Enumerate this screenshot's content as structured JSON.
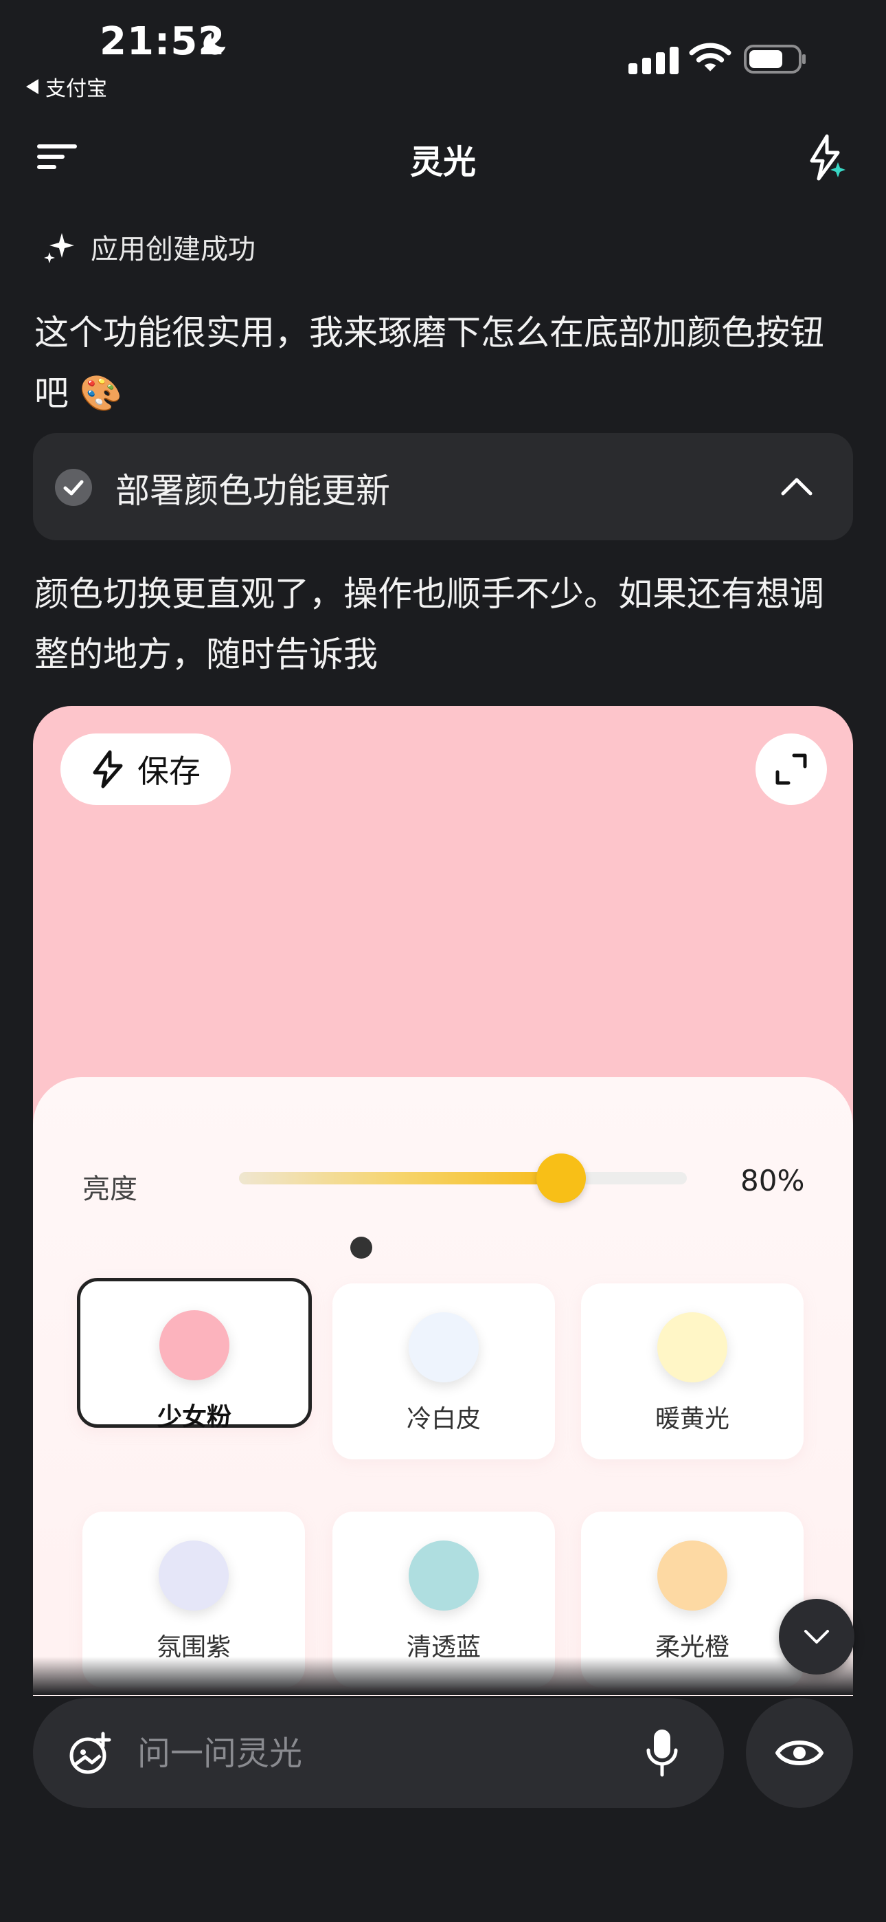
{
  "status_bar": {
    "time": "21:52",
    "back_app": "支付宝",
    "icons": [
      "moon-icon",
      "signal-icon",
      "wifi-icon",
      "battery-icon"
    ]
  },
  "nav": {
    "title": "灵光",
    "icons": [
      "menu-icon",
      "sparkle-star-icon"
    ]
  },
  "chat": {
    "app_created": "应用创建成功",
    "message1": "这个功能很实用，我来琢磨下怎么在底部加颜色按钮吧 🎨",
    "deploy_card": {
      "title": "部署颜色功能更新",
      "status_icon": "check-icon",
      "expand_icon": "chevron-up-icon"
    },
    "message2": "颜色切换更直观了，操作也顺手不少。如果还有想调整的地方，随时告诉我"
  },
  "preview": {
    "save_label": "保存",
    "background_color": "#fdc5cb",
    "brightness": {
      "label": "亮度",
      "value_text": "80%",
      "slider_fraction": 0.72
    },
    "swatches": [
      {
        "name": "少女粉",
        "color": "#fcb3bd",
        "selected": true
      },
      {
        "name": "冷白皮",
        "color": "#eef4fd",
        "selected": false
      },
      {
        "name": "暖黄光",
        "color": "#fff6c6",
        "selected": false
      },
      {
        "name": "氛围紫",
        "color": "#e5e6f8",
        "selected": false
      },
      {
        "name": "清透蓝",
        "color": "#afdee0",
        "selected": false
      },
      {
        "name": "柔光橙",
        "color": "#fdd9a3",
        "selected": false
      }
    ]
  },
  "input": {
    "placeholder": "问一问灵光",
    "icons": [
      "image-add-icon",
      "mic-icon",
      "eye-icon",
      "chevron-down-icon"
    ]
  },
  "colors": {
    "background": "#1b1c1f",
    "card": "#2a2b2e",
    "accent_yellow": "#f8bf17"
  }
}
